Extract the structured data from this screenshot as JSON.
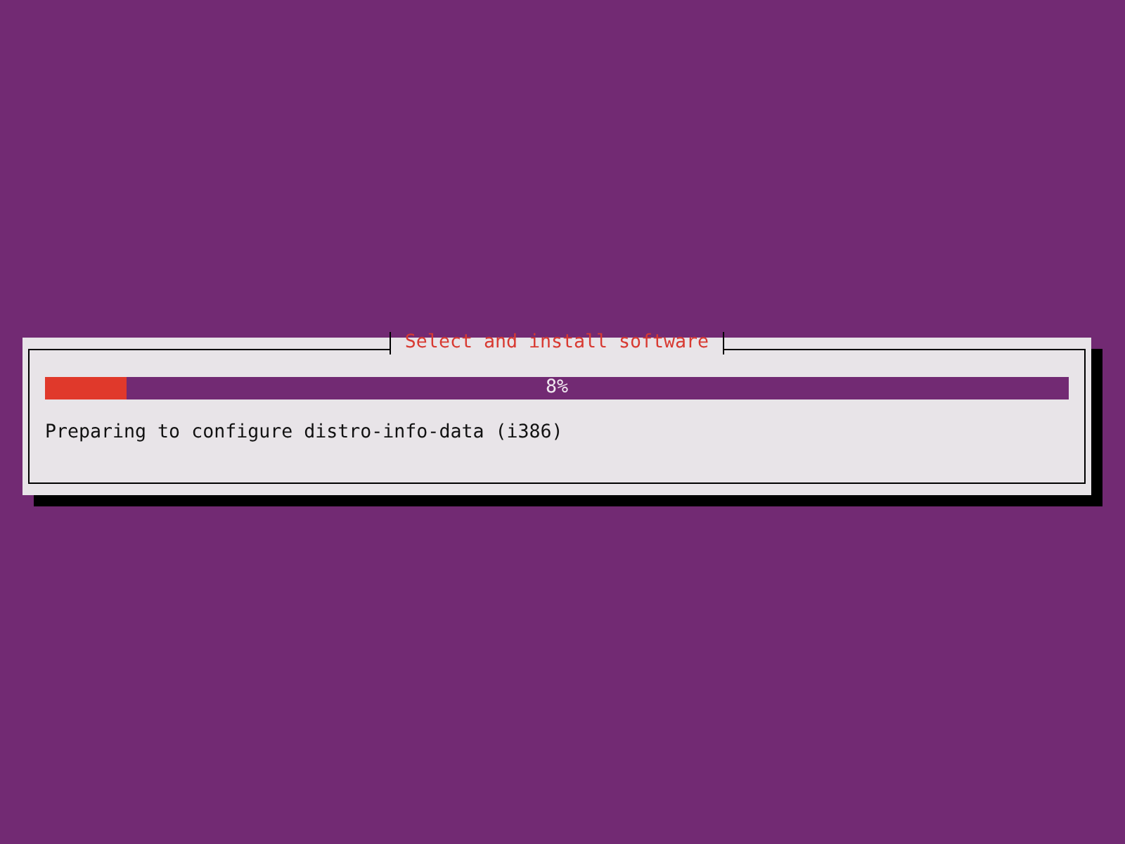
{
  "dialog": {
    "title": "Select and install software",
    "progress": {
      "level": 0.08,
      "reading": "8%"
    },
    "message": "Preparing to configure distro-info-data (i386)"
  }
}
